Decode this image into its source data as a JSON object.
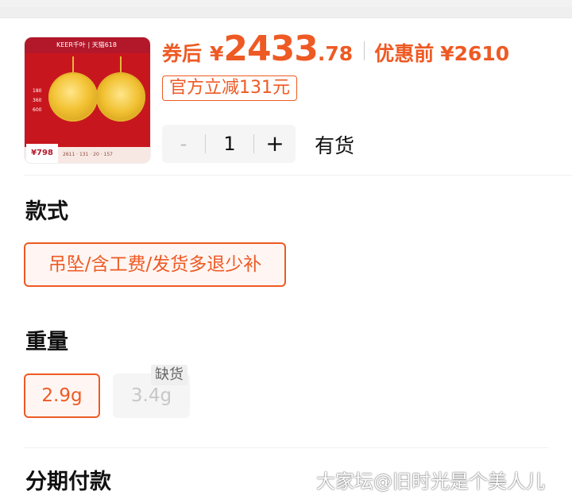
{
  "product": {
    "thumbnail": {
      "brand": "KEER千叶 | 天猫618",
      "side_prices": [
        "180",
        "360",
        "600"
      ],
      "foot_price": "¥798",
      "foot_stats": "2611 · 131 · 20 · 157"
    },
    "price": {
      "coupon_label": "券后",
      "currency": "¥",
      "integer": "2433",
      "decimal": ".78",
      "pre_label": "优惠前",
      "pre_price": "¥2610"
    },
    "discount_tag": "官方立减131元",
    "quantity": {
      "minus": "-",
      "value": "1",
      "plus": "+"
    },
    "stock_status": "有货"
  },
  "sections": {
    "style": {
      "title": "款式",
      "options": [
        "吊坠/含工费/发货多退少补"
      ]
    },
    "weight": {
      "title": "重量",
      "options": [
        "2.9g",
        "3.4g"
      ],
      "oos_badge": "缺货"
    },
    "installment": {
      "title": "分期付款"
    }
  },
  "watermark": "大家坛@旧时光是个美人儿",
  "colors": {
    "accent": "#ee5a24",
    "disabled_bg": "#f5f5f5",
    "thumb_red": "#c8161f"
  }
}
